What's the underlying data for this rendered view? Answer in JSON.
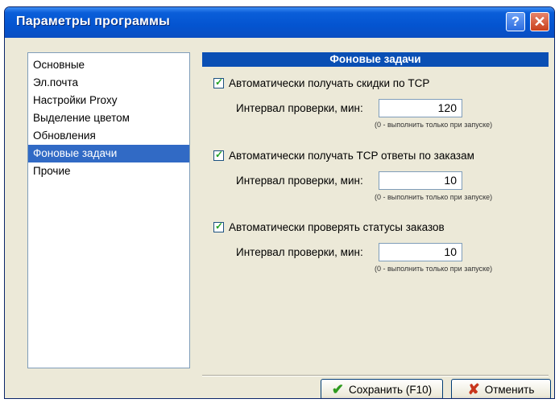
{
  "window": {
    "title": "Параметры программы"
  },
  "titlebar": {
    "help_glyph": "?",
    "close_glyph": "✕"
  },
  "sidebar": {
    "selected_index": 5,
    "items": [
      {
        "label": "Основные"
      },
      {
        "label": "Эл.почта"
      },
      {
        "label": "Настройки Proxy"
      },
      {
        "label": "Выделение цветом"
      },
      {
        "label": "Обновления"
      },
      {
        "label": "Фоновые задачи"
      },
      {
        "label": "Прочие"
      }
    ]
  },
  "panel": {
    "header": "Фоновые задачи",
    "groups": [
      {
        "checkbox_label": "Автоматически получать скидки по TCP",
        "checked": true,
        "interval_label": "Интервал проверки, мин:",
        "interval_value": "120",
        "hint": "(0 - выполнить только при запуске)"
      },
      {
        "checkbox_label": "Автоматически получать TCP ответы по заказам",
        "checked": true,
        "interval_label": "Интервал проверки, мин:",
        "interval_value": "10",
        "hint": "(0 - выполнить только при запуске)"
      },
      {
        "checkbox_label": "Автоматически проверять статусы заказов",
        "checked": true,
        "interval_label": "Интервал проверки, мин:",
        "interval_value": "10",
        "hint": "(0 - выполнить только при запуске)"
      }
    ]
  },
  "buttons": {
    "save_label": "Сохранить (F10)",
    "save_icon": "check-icon",
    "cancel_label": "Отменить",
    "cancel_icon": "cross-icon"
  },
  "colors": {
    "titlebar": "#0454d0",
    "selection": "#316ac5",
    "section_header": "#0a4fb4",
    "window_bg": "#ece9d8"
  }
}
